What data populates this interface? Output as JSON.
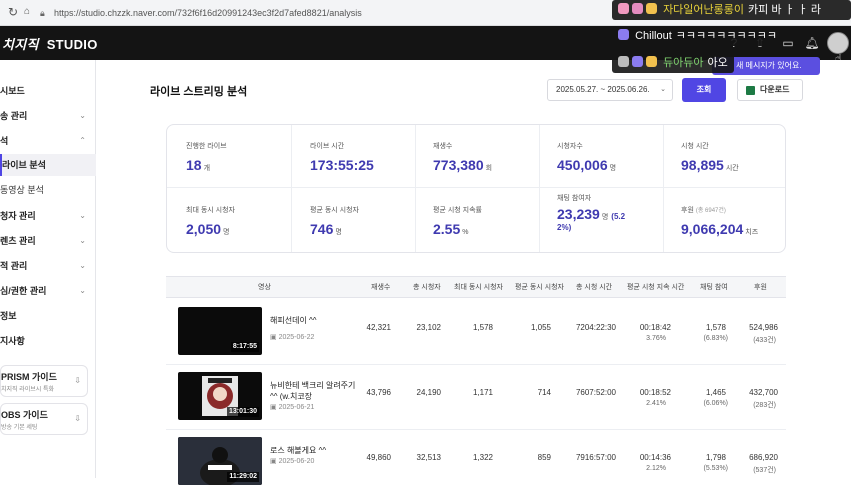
{
  "browser": {
    "url": "https://studio.chzzk.naver.com/732f6f16d20991243ec3f2d7afed8821/analysis"
  },
  "app": {
    "logo_main": "치지직",
    "logo_studio": "STUDIO"
  },
  "chat_overlay": [
    {
      "nick": "자다일어난롱롱이",
      "message": "카피 바 ㅏ ㅏ 라",
      "emoji_colors": [
        "#f19ac0",
        "#e58cc0",
        "#f2c14e"
      ]
    },
    {
      "nick": "Chillout",
      "message": "ㅋㅋㅋㅋㅋㅋㅋㅋㅋㅋ",
      "emoji_colors": [
        "#8b7cf0"
      ]
    },
    {
      "nick": "듀아듀아",
      "message": "아오",
      "emoji_colors": [
        "#bbbbbb",
        "#8b7cf0",
        "#f2c14e"
      ]
    }
  ],
  "tooltip": {
    "text": "새 메시지가 있어요."
  },
  "sidebar": {
    "items": [
      {
        "label": "시보드"
      },
      {
        "label": "송 관리"
      },
      {
        "label": "석"
      },
      {
        "label": "라이브 분석"
      },
      {
        "label": "동영상 분석"
      },
      {
        "label": "청자 관리"
      },
      {
        "label": "렌츠 관리"
      },
      {
        "label": "적 관리"
      },
      {
        "label": "심/권한 관리"
      },
      {
        "label": "정보"
      },
      {
        "label": "지사항"
      }
    ],
    "guides": [
      {
        "title": "PRISM 가이드",
        "sub": "치지직 라이브시 특화"
      },
      {
        "title": "OBS 가이드",
        "sub": "방송 기본 세팅"
      }
    ]
  },
  "main": {
    "title": "라이브 스트리밍 분석",
    "date_range": "2025.05.27. ~ 2025.06.26.",
    "search_label": "조회",
    "download_label": "다운로드"
  },
  "stats": [
    {
      "label": "진행한 라이브",
      "value": "18",
      "unit": "개"
    },
    {
      "label": "라이브 시간",
      "value": "173:55:25",
      "unit": ""
    },
    {
      "label": "재생수",
      "value": "773,380",
      "unit": "회"
    },
    {
      "label": "시청자수",
      "value": "450,006",
      "unit": "명"
    },
    {
      "label": "시청 시간",
      "value": "98,895",
      "unit": "시간"
    },
    {
      "label": "최대 동시 시청자",
      "value": "2,050",
      "unit": "명"
    },
    {
      "label": "평균 동시 시청자",
      "value": "746",
      "unit": "명"
    },
    {
      "label": "평균 시청 지속률",
      "value": "2.55",
      "unit": "%"
    },
    {
      "label": "채팅 참여자",
      "value": "23,239",
      "unit": "명",
      "extra": "(5.2",
      "extra2": "2%)"
    },
    {
      "label": "후원",
      "label_small": "(총 6947건)",
      "value": "9,066,204",
      "unit": "치즈"
    }
  ],
  "table": {
    "headers": [
      "영상",
      "재생수",
      "총 시청자",
      "최대 동시 시청자",
      "평균 동시 시청자",
      "총 시청 시간",
      "평균 시청 지속 시간",
      "채팅 참여",
      "후원"
    ],
    "rows": [
      {
        "duration": "8:17:55",
        "title": "해피선데이 ^^",
        "date": "2025-06-22",
        "plays": "42,321",
        "viewers": "23,102",
        "max": "1,578",
        "avg": "1,055",
        "watch": "7204:22:30",
        "avg_time": "00:18:42",
        "avg_rate": "3.76%",
        "chat": "1,578",
        "chat_rate": "(6.83%)",
        "dona": "524,986",
        "dona_cnt": "(433건)"
      },
      {
        "duration": "13:01:30",
        "title": "뉴비한테 백크리 알려주기 ^^ (w.치코장",
        "date": "2025-06-21",
        "plays": "43,796",
        "viewers": "24,190",
        "max": "1,171",
        "avg": "714",
        "watch": "7607:52:00",
        "avg_time": "00:18:52",
        "avg_rate": "2.41%",
        "chat": "1,465",
        "chat_rate": "(6.06%)",
        "dona": "432,700",
        "dona_cnt": "(283건)"
      },
      {
        "duration": "11:29:02",
        "title": "로스 해볼게요 ^^",
        "date": "2025-06-20",
        "plays": "49,860",
        "viewers": "32,513",
        "max": "1,322",
        "avg": "859",
        "watch": "7916:57:00",
        "avg_time": "00:14:36",
        "avg_rate": "2.12%",
        "chat": "1,798",
        "chat_rate": "(5.53%)",
        "dona": "686,920",
        "dona_cnt": "(537건)"
      }
    ]
  }
}
